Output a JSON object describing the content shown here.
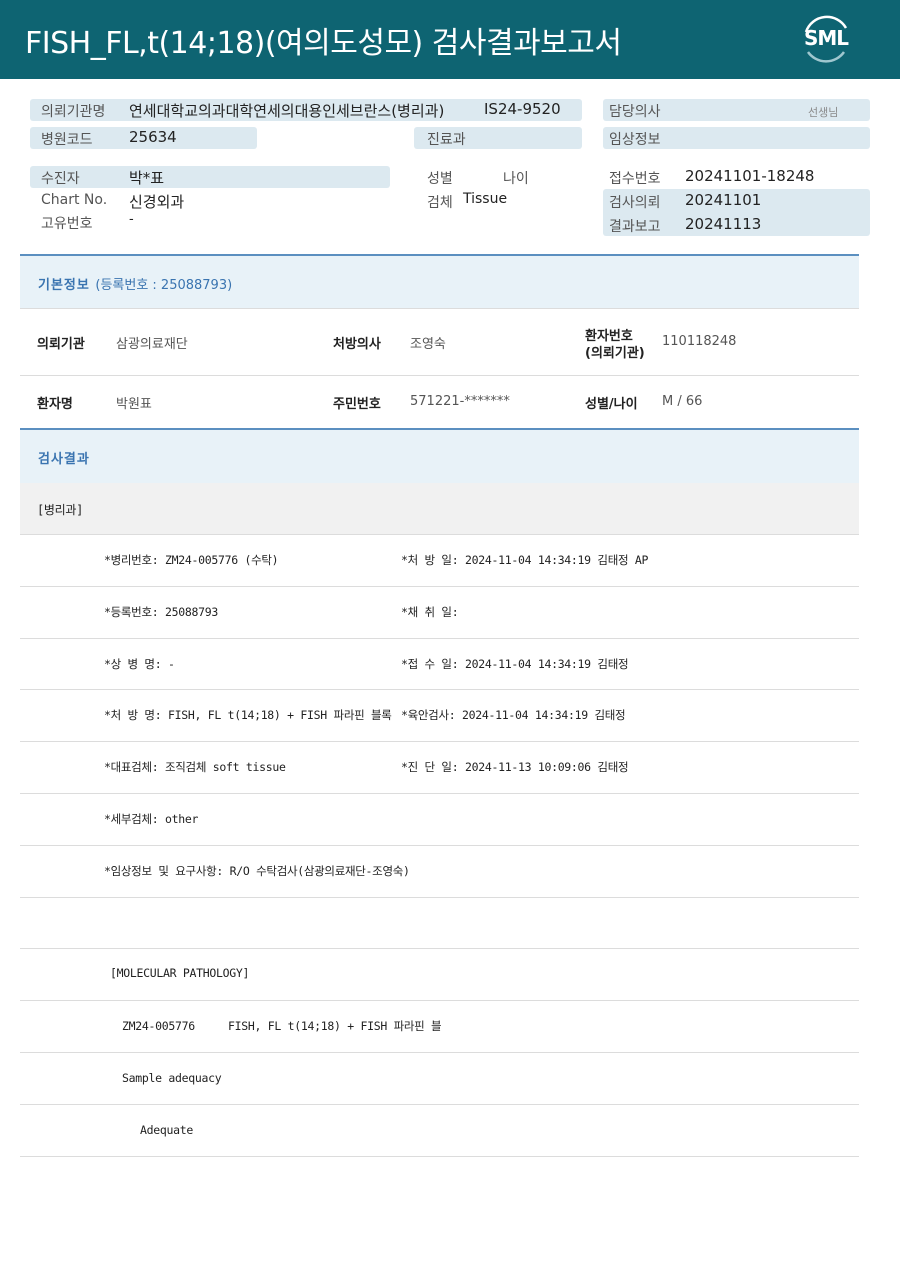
{
  "header": {
    "title": "FISH_FL,t(14;18)(여의도성모) 검사결과보고서",
    "logo_text": "SML"
  },
  "info": {
    "institution_label": "의뢰기관명",
    "institution_value": "연세대학교의과대학연세의대용인세브란스(병리과)",
    "institution_suffix": "병리과",
    "request_no": "IS24-9520",
    "doctor_label": "담당의사",
    "doctor_suffix": "선생님",
    "hospital_code_label": "병원코드",
    "hospital_code_value": "25634",
    "dept_label": "진료과",
    "clinical_label": "임상정보",
    "patient_label": "수진자",
    "patient_value": "박*표",
    "sex_label": "성별",
    "age_label": "나이",
    "receipt_no_label": "접수번호",
    "receipt_no_value": "20241101-18248",
    "chart_label": "Chart No.",
    "chart_value": "신경외과",
    "specimen_label": "검체",
    "specimen_value": "Tissue",
    "request_date_label": "검사의뢰",
    "request_date_value": "20241101",
    "unique_label": "고유번호",
    "unique_value": "-",
    "report_date_label": "결과보고",
    "report_date_value": "20241113"
  },
  "basic": {
    "section_title": "기본정보",
    "section_sub": "(등록번호 : 25088793)",
    "row1": {
      "inst_label": "의뢰기관",
      "inst_value": "삼광의료재단",
      "doc_label": "처방의사",
      "doc_value": "조영숙",
      "pt_no_label_1": "환자번호",
      "pt_no_label_2": "(의뢰기관)",
      "pt_no_value": "110118248"
    },
    "row2": {
      "name_label": "환자명",
      "name_value": "박원표",
      "rrn_label": "주민번호",
      "rrn_value": "571221-*******",
      "sexage_label": "성별/나이",
      "sexage_value": "M / 66"
    }
  },
  "results": {
    "section_title": "검사결과",
    "dept": "[병리과]",
    "lines": [
      {
        "left": "*병리번호: ZM24-005776 (수탁)",
        "right": "*처 방 일: 2024-11-04 14:34:19  김태정 AP"
      },
      {
        "left": "*등록번호: 25088793",
        "right": "*채 취 일:"
      },
      {
        "left": "*상 병 명: -",
        "right": "*접 수 일: 2024-11-04 14:34:19  김태정"
      },
      {
        "left": "*처 방 명: FISH, FL t(14;18) + FISH 파라핀 블록",
        "right": "*육안검사: 2024-11-04 14:34:19  김태정"
      },
      {
        "left": "*대표검체: 조직검체 soft tissue",
        "right": "*진 단 일: 2024-11-13 10:09:06  김태정"
      },
      {
        "left": "*세부검체: other",
        "right": ""
      },
      {
        "left": "*임상정보 및 요구사항: R/O 수탁검사(삼광의료재단-조영숙)",
        "right": ""
      }
    ],
    "mol_title": "[MOLECULAR PATHOLOGY]",
    "mol_test": "ZM24-005776     FISH, FL t(14;18) + FISH 파라핀 블",
    "adequacy_label": "Sample adequacy",
    "adequacy_value": "Adequate"
  }
}
